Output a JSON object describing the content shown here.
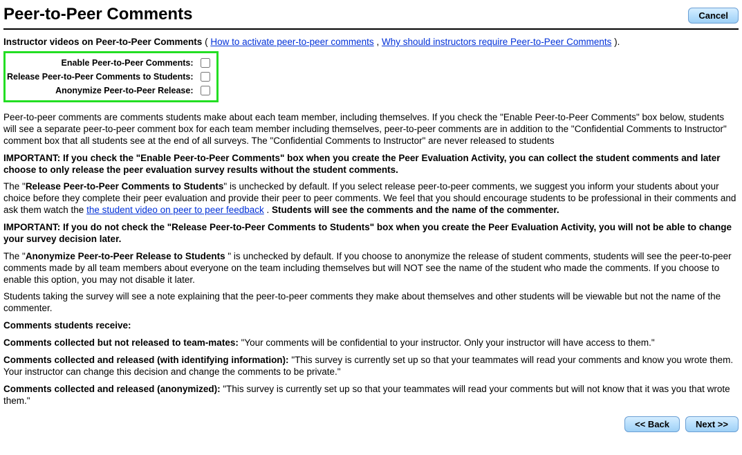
{
  "header": {
    "title": "Peer-to-Peer Comments",
    "cancel": "Cancel"
  },
  "intro": {
    "lead_bold": "Instructor videos on Peer-to-Peer Comments",
    "open_paren": " ( ",
    "link1": "How to activate peer-to-peer comments",
    "sep": " ,  ",
    "link2": "Why should instructors require Peer-to-Peer Comments",
    "close_paren": " )."
  },
  "options": {
    "enable_label": "Enable Peer-to-Peer Comments:",
    "release_label": "Release Peer-to-Peer Comments to Students:",
    "anonymize_label": "Anonymize Peer-to-Peer Release:"
  },
  "p1": "Peer-to-peer comments are comments students make about each team member, including themselves. If you check the \"Enable Peer-to-Peer Comments\" box below, students will see a separate peer-to-peer comment box for each team member including themselves, peer-to-peer comments are in addition to the \"Confidential Comments to Instructor\" comment box that all students see at the end of all surveys. The \"Confidential Comments to Instructor\" are never released to students",
  "p2": "IMPORTANT: If you check the \"Enable Peer-to-Peer Comments\" box when you create the Peer Evaluation Activity, you can collect the student comments and later choose to only release the peer evaluation survey results without the student comments.",
  "p3": {
    "pre": "The \"",
    "bold1": "Release Peer-to-Peer Comments to Students",
    "mid1": "\" is unchecked by default. If you select release peer-to-peer comments, we suggest you inform your students about your choice before they complete their peer evaluation and provide their peer to peer comments. We feel that you should encourage students to be professional in their comments and ask them watch the ",
    "link": "the student video on peer to peer feedback",
    "mid2": " . ",
    "bold2": "Students will see the comments and the name of the commenter."
  },
  "p4": "IMPORTANT: If you do not check the \"Release Peer-to-Peer Comments to Students\" box when you create the Peer Evaluation Activity, you will not be able to change your survey decision later.",
  "p5": {
    "pre": "The \"",
    "bold": "Anonymize Peer-to-Peer Release to Students ",
    "rest": "\" is unchecked by default. If you choose to anonymize the release of student comments, students will see the peer-to-peer comments made by all team members about everyone on the team including themselves but will NOT see the name of the student who made the comments. If you choose to enable this option, you may not disable it later."
  },
  "p6": "Students taking the survey will see a note explaining that the peer-to-peer comments they make about themselves and other students will be viewable but not the name of the commenter.",
  "p7": "Comments students receive:",
  "p8": {
    "bold": "Comments collected but not released to team-mates:",
    "rest": " \"Your comments will be confidential to your instructor. Only your instructor will have access to them.\""
  },
  "p9": {
    "bold": "Comments collected and released (with identifying information):",
    "rest": " \"This survey is currently set up so that your teammates will read your comments and know you wrote them. Your instructor can change this decision and change the comments to be private.\""
  },
  "p10": {
    "bold": "Comments collected and released (anonymized):",
    "rest": " \"This survey is currently set up so that your teammates will read your comments but will not know that it was you that wrote them.\""
  },
  "footer": {
    "back": "<< Back",
    "next": "Next >>"
  }
}
